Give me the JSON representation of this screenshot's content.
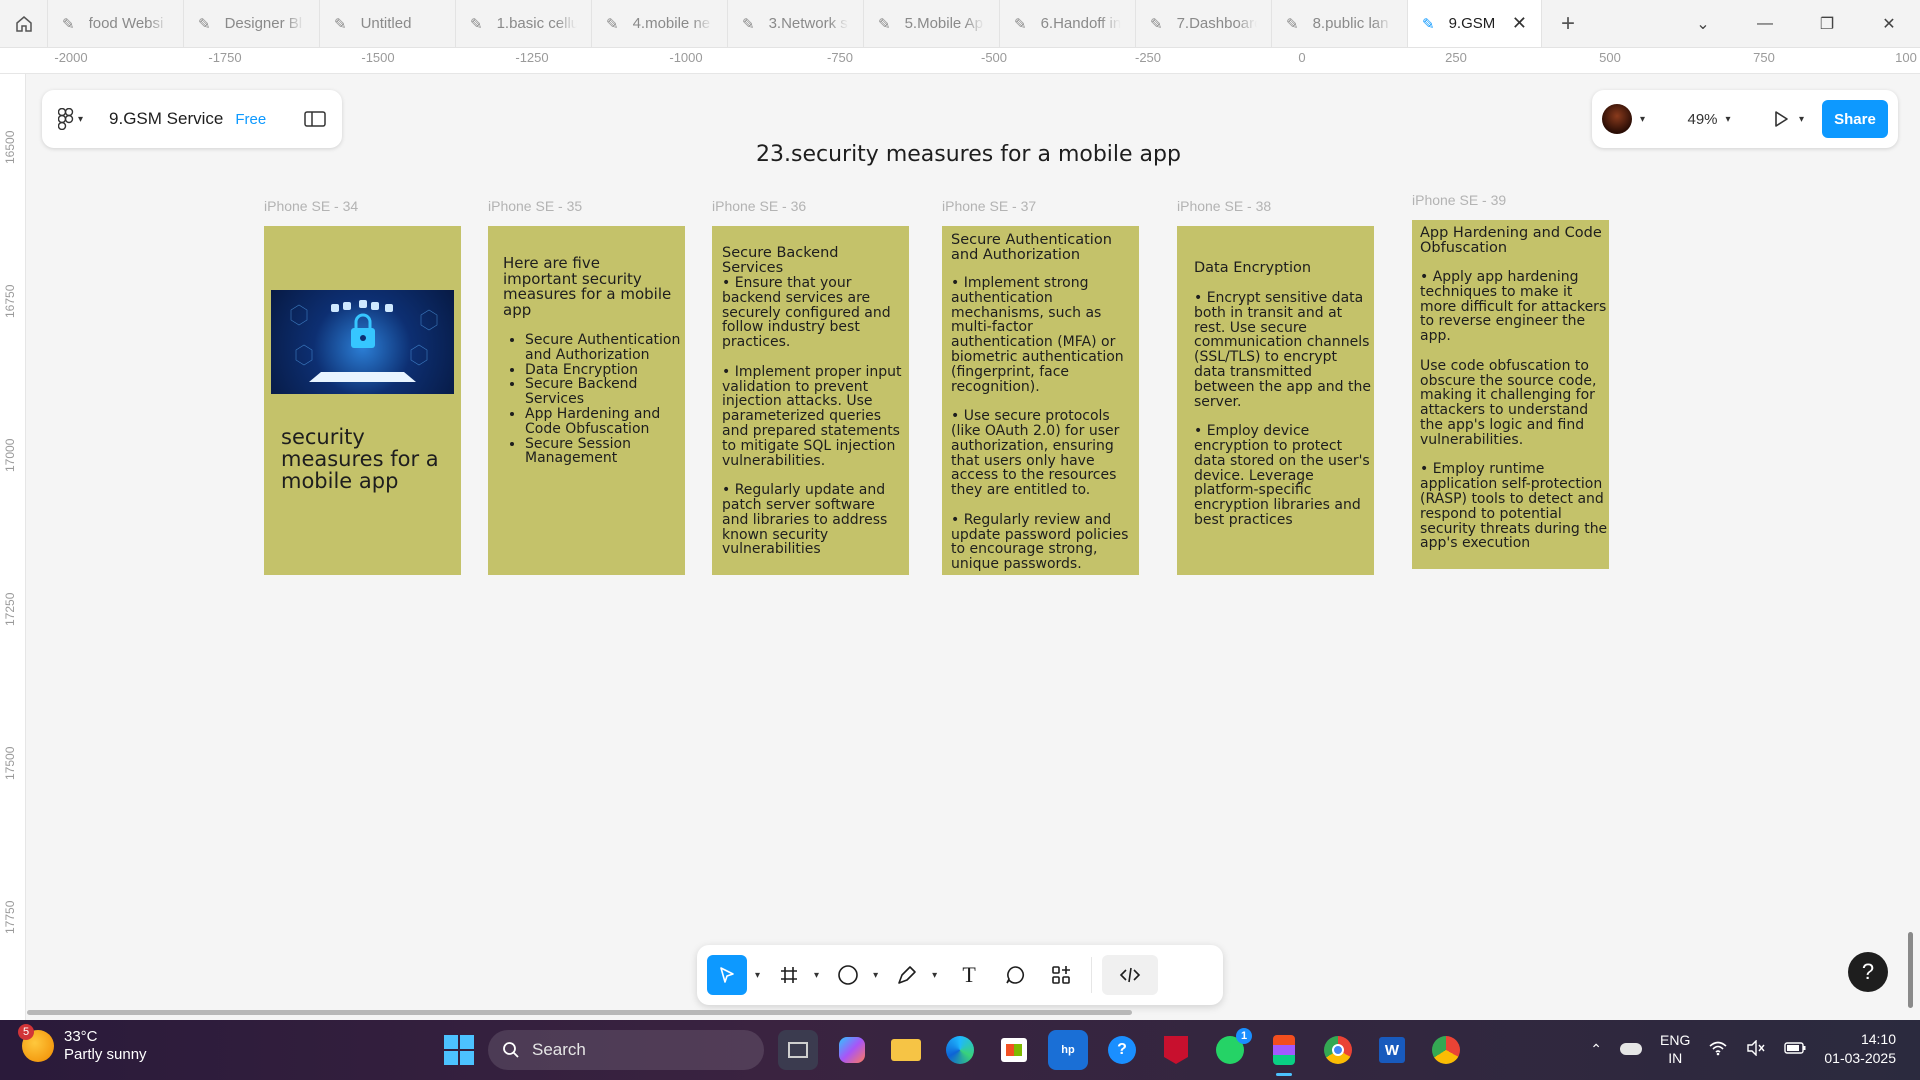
{
  "tabs": [
    {
      "label": "food Websi"
    },
    {
      "label": "Designer Bl"
    },
    {
      "label": "Untitled"
    },
    {
      "label": "1.basic cellu"
    },
    {
      "label": "4.mobile ne"
    },
    {
      "label": "3.Network s"
    },
    {
      "label": "5.Mobile Ap"
    },
    {
      "label": "6.Handoff in"
    },
    {
      "label": "7.Dashboarc"
    },
    {
      "label": "8.public lan"
    },
    {
      "label": "9.GSM"
    }
  ],
  "ruler_top": [
    "-2000",
    "-1750",
    "-1500",
    "-1250",
    "-1000",
    "-750",
    "-500",
    "-250",
    "0",
    "250",
    "500",
    "750",
    "100"
  ],
  "ruler_left": [
    "16500",
    "16750",
    "17000",
    "17250",
    "17500",
    "17750"
  ],
  "file": {
    "name": "9.GSM Service",
    "plan": "Free"
  },
  "zoom": "49%",
  "share_label": "Share",
  "page_title": "23.security measures for a mobile app",
  "frames": [
    {
      "label": "iPhone SE - 34",
      "cover_title": "security measures for a mobile app"
    },
    {
      "label": "iPhone SE - 35",
      "heading": "Here are five important security measures for a mobile app",
      "bullets": [
        "Secure Authentication and Authorization",
        "Data Encryption",
        "Secure Backend Services",
        "App Hardening and Code Obfuscation",
        "Secure Session Management"
      ]
    },
    {
      "label": "iPhone SE - 36",
      "heading": "Secure Backend Services",
      "body": "• Ensure that your backend services are securely configured and follow industry best practices.\n\n• Implement proper input validation to prevent injection attacks. Use parameterized queries and prepared statements to mitigate SQL injection vulnerabilities.\n\n• Regularly update and patch server software and libraries to address known security vulnerabilities"
    },
    {
      "label": "iPhone SE - 37",
      "heading": "Secure Authentication and Authorization",
      "body": "• Implement strong authentication mechanisms, such as multi-factor authentication (MFA) or biometric authentication (fingerprint, face recognition).\n\n• Use secure protocols (like OAuth 2.0) for user authorization, ensuring that users only have access to the resources they are entitled to.\n\n• Regularly review and update password policies to encourage strong, unique passwords."
    },
    {
      "label": "iPhone SE - 38",
      "heading": "Data Encryption",
      "body": "• Encrypt sensitive data both in transit and at rest. Use secure communication channels (SSL/TLS) to encrypt data transmitted between the app and the server.\n\n• Employ device encryption to protect data stored on the user's device. Leverage platform-specific encryption libraries and best practices"
    },
    {
      "label": "iPhone SE - 39",
      "heading": "App Hardening and Code Obfuscation",
      "body": "• Apply app hardening techniques to make it more difficult for attackers to reverse engineer the app.\n\nUse code obfuscation to obscure the source code, making it challenging for attackers to understand the app's logic and find vulnerabilities.\n\n• Employ runtime application self-protection (RASP) tools to detect and respond to potential security threats during the app's execution"
    }
  ],
  "help_label": "?",
  "taskbar": {
    "weather_badge": "5",
    "temp": "33°C",
    "condition": "Partly sunny",
    "search_label": "Search",
    "lang_line1": "ENG",
    "lang_line2": "IN",
    "time": "14:10",
    "date": "01-03-2025",
    "whatsapp_badge": "1"
  },
  "colors": {
    "frame_fill": "#c4c26a",
    "accent": "#0d99ff",
    "canvas": "#f5f5f5"
  }
}
